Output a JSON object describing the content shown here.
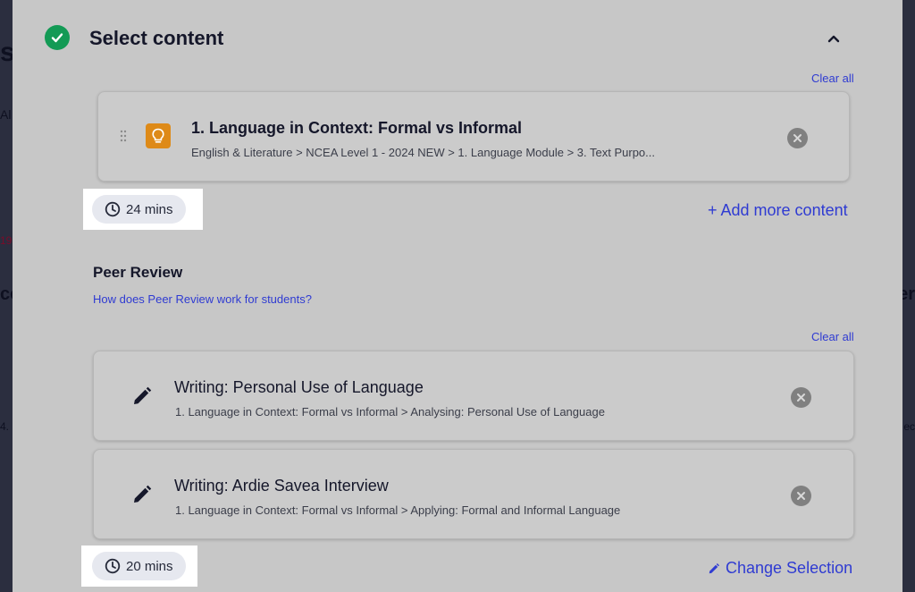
{
  "background": {
    "fragments": [
      "s",
      "Al",
      "19",
      "cc",
      "4.",
      "er",
      "ec"
    ]
  },
  "section": {
    "title": "Select content",
    "collapse_icon": "chevron-up-icon",
    "status_icon": "check-circle-icon",
    "accent": "#139a55"
  },
  "content": {
    "clear_all": "Clear all",
    "item": {
      "title": "1. Language in Context: Formal vs Informal",
      "path": "English & Literature > NCEA Level 1 - 2024 NEW > 1. Language Module > 3. Text Purpo...",
      "icon": "lightbulb-icon",
      "icon_color": "#de8a18"
    },
    "duration": "24 mins",
    "add_more": "+ Add more content"
  },
  "peer_review": {
    "title": "Peer Review",
    "help_link": "How does Peer Review work for students?",
    "clear_all": "Clear all",
    "items": [
      {
        "title": "Writing: Personal Use of Language",
        "path": "1. Language in Context: Formal vs Informal > Analysing: Personal Use of Language",
        "icon": "pencil-icon"
      },
      {
        "title": "Writing: Ardie Savea Interview",
        "path": "1. Language in Context: Formal vs Informal > Applying: Formal and Informal Language",
        "icon": "pencil-icon"
      }
    ],
    "duration": "20 mins",
    "change_selection": "Change Selection"
  },
  "colors": {
    "link": "#2f3bd2",
    "overlay_panel": "#c7c7c7"
  }
}
